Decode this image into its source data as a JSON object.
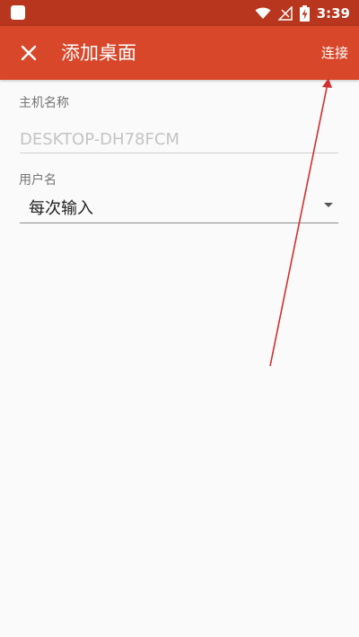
{
  "status_bar": {
    "time": "3:39",
    "icons": [
      "app-notification-icon",
      "wifi-icon",
      "no-signal-icon",
      "battery-charging-icon"
    ]
  },
  "app_bar": {
    "title": "添加桌面",
    "close_icon": "close-icon",
    "connect_label": "连接"
  },
  "form": {
    "hostname": {
      "label": "主机名称",
      "value": "",
      "placeholder": "DESKTOP-DH78FCM"
    },
    "username": {
      "label": "用户名",
      "selected": "每次输入"
    }
  },
  "colors": {
    "status_bar": "#b8361e",
    "app_bar": "#d9472b",
    "background": "#fafafa",
    "annotation_arrow": "#d32f2f"
  }
}
